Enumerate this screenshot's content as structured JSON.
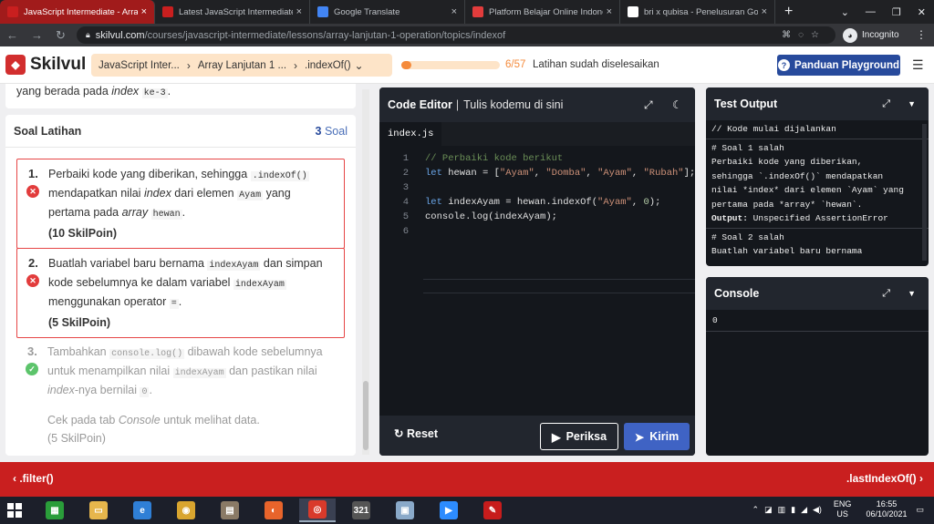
{
  "browser": {
    "tabs": [
      {
        "title": "JavaScript Intermediate - Array",
        "active": true,
        "fav_color": "#c91f1f",
        "icon": "skilvul-icon"
      },
      {
        "title": "Latest JavaScript Intermediate",
        "active": false,
        "fav_color": "#c91f1f",
        "icon": "skilvul-icon"
      },
      {
        "title": "Google Translate",
        "active": false,
        "fav_color": "#4285f4",
        "icon": "translate-icon"
      },
      {
        "title": "Platform Belajar Online Indone",
        "active": false,
        "fav_color": "#e23c3c",
        "icon": "quora-icon"
      },
      {
        "title": "bri x qubisa - Penelusuran Goo",
        "active": false,
        "fav_color": "#ffffff",
        "icon": "google-icon"
      }
    ],
    "new_tab": "+",
    "url_domain": "skilvul.com",
    "url_path": "/courses/javascript-intermediate/lessons/array-lanjutan-1-operation/topics/indexof",
    "profile": "Incognito"
  },
  "header": {
    "logo": "Skilvul",
    "crumbs": [
      "JavaScript Inter...",
      "Array Lanjutan 1 ...",
      ".indexOf()"
    ],
    "progress_fraction": 0.105,
    "progress_count": "6/57",
    "progress_text": "Latihan sudah diselesaikan",
    "guide_button": "Panduan Playground",
    "accent": "#274a9c",
    "brand": "#c91f1f"
  },
  "left": {
    "intro_pre": "yang berada pada ",
    "intro_em": "index",
    "intro_code": "ke-3",
    "intro_post": ".",
    "section_title": "Soal Latihan",
    "count_num": "3",
    "count_label": " Soal",
    "tasks": [
      {
        "num": "1.",
        "status": "error",
        "p1": "Perbaiki kode yang diberikan, sehingga ",
        "c1": ".indexOf()",
        "p2": " mendapatkan nilai ",
        "e1": "index",
        "p3": " dari elemen ",
        "c2": "Ayam",
        "p4": " yang pertama pada ",
        "e2": "array",
        "p5": " ",
        "c3": "hewan",
        "p6": ".",
        "points": "(10 SkilPoin)"
      },
      {
        "num": "2.",
        "status": "error",
        "p1": "Buatlah variabel baru bernama ",
        "c1": "indexAyam",
        "p2": " dan simpan kode sebelumnya ke dalam variabel ",
        "c2": "indexAyam",
        "p3": " menggunakan operator ",
        "c3": "=",
        "p4": ".",
        "points": "(5 SkilPoin)"
      },
      {
        "num": "3.",
        "status": "ok",
        "p1": "Tambahkan ",
        "c1": "console.log()",
        "p2": " dibawah kode sebelumnya untuk menampilkan nilai ",
        "c2": "indexAyam",
        "p3": " dan pastikan nilai ",
        "e1": "index",
        "p4": "-nya bernilai ",
        "c3": "0",
        "p5": ".",
        "note_pre": "Cek pada tab ",
        "note_em": "Console",
        "note_post": " untuk melihat data.",
        "points": "(5 SkilPoin)"
      }
    ]
  },
  "editor": {
    "title": "Code Editor",
    "subtitle": "Tulis kodemu di sini",
    "file_tab": "index.js",
    "lines": [
      {
        "n": "1",
        "html_parts": [
          {
            "cls": "cm",
            "t": "// Perbaiki kode berikut"
          }
        ]
      },
      {
        "n": "2",
        "html_parts": [
          {
            "cls": "kw",
            "t": "let"
          },
          {
            "cls": "",
            "t": " hewan = ["
          },
          {
            "cls": "st",
            "t": "\"Ayam\""
          },
          {
            "cls": "",
            "t": ", "
          },
          {
            "cls": "st",
            "t": "\"Domba\""
          },
          {
            "cls": "",
            "t": ", "
          },
          {
            "cls": "st",
            "t": "\"Ayam\""
          },
          {
            "cls": "",
            "t": ", "
          },
          {
            "cls": "st",
            "t": "\"Rubah\""
          },
          {
            "cls": "",
            "t": "];"
          }
        ]
      },
      {
        "n": "3",
        "html_parts": []
      },
      {
        "n": "4",
        "html_parts": [
          {
            "cls": "kw",
            "t": "let"
          },
          {
            "cls": "",
            "t": " indexAyam = hewan.indexOf("
          },
          {
            "cls": "st",
            "t": "\"Ayam\""
          },
          {
            "cls": "",
            "t": ", "
          },
          {
            "cls": "nm",
            "t": "0"
          },
          {
            "cls": "",
            "t": ");"
          }
        ]
      },
      {
        "n": "5",
        "html_parts": [
          {
            "cls": "",
            "t": "console.log(indexAyam);"
          }
        ]
      },
      {
        "n": "6",
        "html_parts": []
      }
    ],
    "reset_label": "Reset",
    "check_label": "Periksa",
    "submit_label": "Kirim"
  },
  "test_output": {
    "title": "Test Output",
    "start": "// Kode mulai dijalankan",
    "blocks": [
      {
        "head": "# Soal 1 salah",
        "lines": [
          "Perbaiki kode yang diberikan,",
          "sehingga `.indexOf()` mendapatkan",
          "nilai *index* dari elemen `Ayam` yang",
          "pertama pada *array* `hewan`."
        ],
        "out_label": "Output:",
        "out_val": " Unspecified AssertionError"
      },
      {
        "head": "# Soal 2 salah",
        "lines": [
          "Buatlah variabel baru bernama"
        ]
      }
    ]
  },
  "console": {
    "title": "Console",
    "output": "0"
  },
  "footer": {
    "prev": ".filter()",
    "next": ".lastIndexOf()"
  },
  "taskbar": {
    "lang_1": "ENG",
    "lang_2": "US",
    "time": "16:55",
    "date": "06/10/2021",
    "apps": [
      {
        "name": "store-icon",
        "color": "#2a9d3a",
        "glyph": "▦"
      },
      {
        "name": "file-explorer-icon",
        "color": "#e6b64c",
        "glyph": "▭"
      },
      {
        "name": "internet-explorer-icon",
        "color": "#2f7fd6",
        "glyph": "e"
      },
      {
        "name": "chrome-beta-icon",
        "color": "#d9a52f",
        "glyph": "◉"
      },
      {
        "name": "archive-icon",
        "color": "#8a7a66",
        "glyph": "▤"
      },
      {
        "name": "firefox-icon",
        "color": "#e8642b",
        "glyph": "◐"
      },
      {
        "name": "chrome-icon",
        "color": "#d93a2b",
        "glyph": "◎"
      },
      {
        "name": "calendar-app-icon",
        "color": "#555",
        "glyph": "321"
      },
      {
        "name": "image-viewer-icon",
        "color": "#8aa9c9",
        "glyph": "▣"
      },
      {
        "name": "zoom-icon",
        "color": "#2d8cff",
        "glyph": "▶"
      },
      {
        "name": "pdf-icon",
        "color": "#c71c1c",
        "glyph": "✎"
      }
    ]
  }
}
